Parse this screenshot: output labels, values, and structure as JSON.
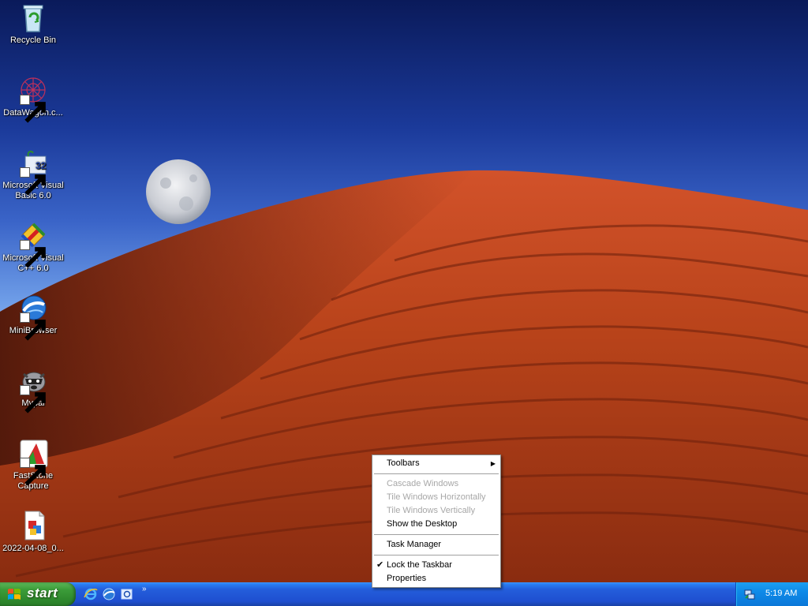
{
  "desktop": {
    "icons": [
      {
        "label": "Recycle Bin",
        "icon": "recycle-bin-icon"
      },
      {
        "label": "DataWagon.c...",
        "icon": "datawagon-icon"
      },
      {
        "label": "Microsoft Visual Basic 6.0",
        "icon": "visual-basic-icon"
      },
      {
        "label": "Microsoft Visual C++ 6.0",
        "icon": "visual-cpp-icon"
      },
      {
        "label": "MiniBrowser",
        "icon": "minibrowser-icon"
      },
      {
        "label": "Mypal",
        "icon": "mypal-icon"
      },
      {
        "label": "FastStone Capture",
        "icon": "faststone-capture-icon"
      },
      {
        "label": "2022-04-08_0...",
        "icon": "image-file-icon"
      }
    ]
  },
  "taskbar": {
    "start_label": "start",
    "quick_launch": [
      "internet-explorer-icon",
      "minibrowser-icon",
      "outlook-express-icon"
    ],
    "chevron": "»",
    "clock": "5:19 AM",
    "tray_icon": "network-tray-icon"
  },
  "context_menu": {
    "items": [
      {
        "label": "Toolbars",
        "enabled": true,
        "submenu": true
      },
      {
        "label": "Cascade Windows",
        "enabled": false
      },
      {
        "label": "Tile Windows Horizontally",
        "enabled": false
      },
      {
        "label": "Tile Windows Vertically",
        "enabled": false
      },
      {
        "label": "Show the Desktop",
        "enabled": true
      },
      {
        "label": "Task Manager",
        "enabled": true
      },
      {
        "label": "Lock the Taskbar",
        "enabled": true,
        "checked": true
      },
      {
        "label": "Properties",
        "enabled": true
      }
    ]
  },
  "colors": {
    "taskbar_blue": "#245edb",
    "start_green": "#3c9d3a",
    "tray_blue": "#0e8ae8",
    "sand": "#b8431a"
  }
}
